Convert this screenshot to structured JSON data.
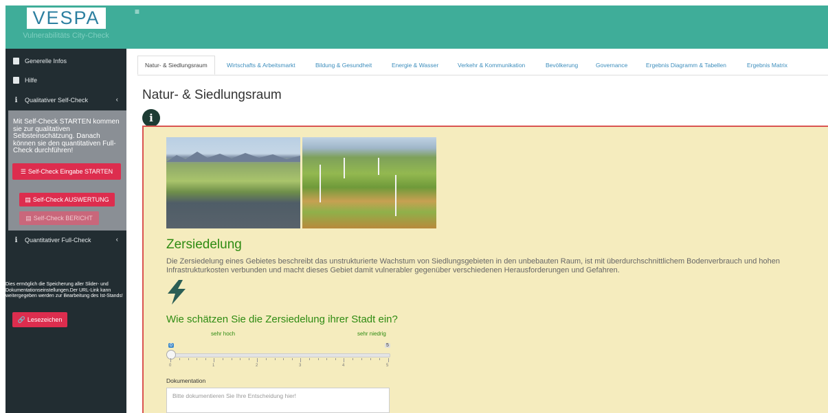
{
  "app": {
    "logo_text": "VESPA",
    "subtitle": "Vulnerabilitäts City-Check",
    "menu_icon": "≡"
  },
  "sidebar": {
    "items": [
      {
        "label": "Generelle Infos",
        "icon": "doc-icon"
      },
      {
        "label": "Hilfe",
        "icon": "doc-icon"
      },
      {
        "label": "Qualitativer Self-Check",
        "icon": "info-icon"
      },
      {
        "label": "Quantitativer Full-Check",
        "icon": "info-icon"
      }
    ],
    "panel_text": "Mit Self-Check STARTEN kommen sie zur qualitativen Selbsteinschätzung. Danach können sie den quantitativen Full-Check durchführen!",
    "start_button": "Self-Check Eingabe STARTEN",
    "evaluation_button": "Self-Check AUSWERTUNG",
    "report_button": "Self-Check BERICHT",
    "note": "Dies ermöglich die Speicherung aller Slider- und Dokumentationseinstellungen.Der URL-Link kann weitergegeben werden zur Bearbeitung des Ist-Stands!",
    "bookmark_button": "Lesezeichen"
  },
  "tabs": [
    "Natur- & Siedlungsraum",
    "Wirtschafts & Arbeitsmarkt",
    "Bildung & Gesundheit",
    "Energie & Wasser",
    "Verkehr & Kommunikation",
    "Bevölkerung",
    "Governance",
    "Ergebnis Diagramm & Tabellen",
    "Ergebnis Matrix"
  ],
  "main": {
    "title": "Natur- & Siedlungsraum",
    "section_heading": "Zersiedelung",
    "description": "Die Zersiedelung eines Gebietes beschreibt das unstrukturierte Wachstum von Siedlungsgebieten in den unbebauten Raum, ist mit überdurchschnittlichem Bodenverbrauch und hohen Infrastrukturkosten verbunden und macht dieses Gebiet damit vulnerabler gegenüber verschiedenen Herausforderungen und Gefahren.",
    "question": "Wie schätzen Sie die Zersiedelung ihrer Stadt ein?",
    "slider": {
      "label_left": "sehr hoch",
      "label_right": "sehr niedrig",
      "value": "0",
      "max": "5",
      "ticks": [
        "0",
        "1",
        "2",
        "3",
        "4",
        "5"
      ]
    },
    "doc_label": "Dokumentation",
    "doc_placeholder": "Bitte dokumentieren Sie Ihre Entscheidung hier!"
  },
  "colors": {
    "header": "#3fad99",
    "sidebar": "#222d32",
    "accent_red": "#dd2d4e",
    "heading_green": "#2e8b12",
    "content_bg": "#f5ecbe"
  }
}
